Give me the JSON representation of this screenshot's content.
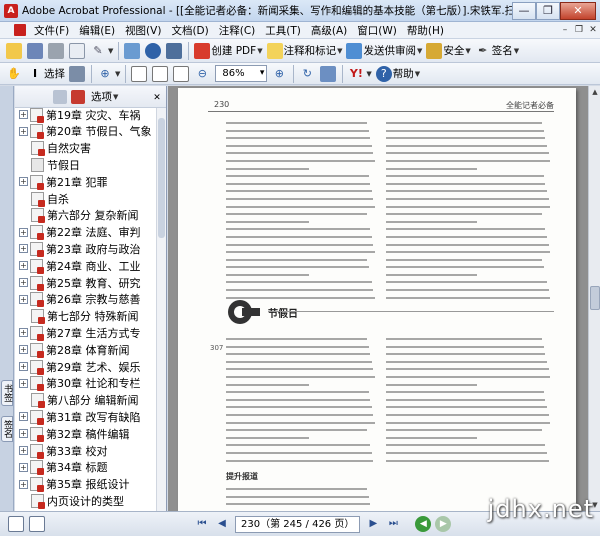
{
  "window": {
    "title": "Adobe Acrobat Professional - [[全能记者必备：新闻采集、写作和编辑的基本技能（第七版）].宋铁军.扫描版.pdf]",
    "minimize": "—",
    "restore": "❐",
    "close": "✕"
  },
  "menu": [
    "文件(F)",
    "编辑(E)",
    "视图(V)",
    "文档(D)",
    "注释(C)",
    "工具(T)",
    "高级(A)",
    "窗口(W)",
    "帮助(H)"
  ],
  "toolbar1": {
    "create_pdf": "创建 PDF",
    "comment_markup": "注释和标记",
    "send_review": "发送供审阅",
    "security": "安全",
    "sign": "签名"
  },
  "toolbar2": {
    "select": "选择",
    "zoom": "86%",
    "help": "帮助"
  },
  "left_tabs": {
    "bookmarks": "书签",
    "signatures": "签名"
  },
  "bookmarks_panel": {
    "options": "选项"
  },
  "bookmarks": [
    {
      "label": "第19章 灾灾、车祸",
      "level": 0,
      "expanded": true,
      "icon": "red"
    },
    {
      "label": "第20章 节假日、气象",
      "level": 0,
      "expanded": true,
      "icon": "red"
    },
    {
      "label": "自然灾害",
      "level": 1,
      "icon": "red"
    },
    {
      "label": "节假日",
      "level": 1,
      "icon": "gray"
    },
    {
      "label": "第21章 犯罪",
      "level": 0,
      "expanded": true,
      "icon": "red"
    },
    {
      "label": "自杀",
      "level": 1,
      "icon": "red"
    },
    {
      "label": "第六部分 复杂新闻",
      "level": 1,
      "icon": "red"
    },
    {
      "label": "第22章 法庭、审判",
      "level": 0,
      "expanded": true,
      "icon": "red"
    },
    {
      "label": "第23章 政府与政治",
      "level": 0,
      "expanded": true,
      "icon": "red"
    },
    {
      "label": "第24章 商业、工业",
      "level": 0,
      "expanded": true,
      "icon": "red"
    },
    {
      "label": "第25章 教育、研究",
      "level": 0,
      "expanded": true,
      "icon": "red"
    },
    {
      "label": "第26章 宗教与慈善",
      "level": 0,
      "expanded": true,
      "icon": "red"
    },
    {
      "label": "第七部分 特殊新闻",
      "level": 1,
      "icon": "red"
    },
    {
      "label": "第27章 生活方式专",
      "level": 0,
      "expanded": true,
      "icon": "red"
    },
    {
      "label": "第28章 体育新闻",
      "level": 0,
      "expanded": true,
      "icon": "red"
    },
    {
      "label": "第29章 艺术、娱乐",
      "level": 0,
      "expanded": true,
      "icon": "red"
    },
    {
      "label": "第30章 社论和专栏",
      "level": 0,
      "expanded": true,
      "icon": "red"
    },
    {
      "label": "第八部分 编辑新闻",
      "level": 1,
      "icon": "red"
    },
    {
      "label": "第31章 改写有缺陷",
      "level": 0,
      "expanded": true,
      "icon": "red"
    },
    {
      "label": "第32章 稿件编辑",
      "level": 0,
      "expanded": true,
      "icon": "red"
    },
    {
      "label": "第33章 校对",
      "level": 0,
      "expanded": true,
      "icon": "red"
    },
    {
      "label": "第34章 标题",
      "level": 0,
      "expanded": true,
      "icon": "red"
    },
    {
      "label": "第35章 报纸设计",
      "level": 0,
      "expanded": true,
      "icon": "red"
    },
    {
      "label": "内页设计的类型",
      "level": 1,
      "icon": "red"
    }
  ],
  "page": {
    "page_number": "230",
    "running_head": "全能记者必备",
    "section_title": "节假日",
    "margin_note": "307",
    "subhead": "提升报道"
  },
  "status": {
    "page_indicator": "230（第 245 / 426 页）"
  },
  "watermark": "jdhx.net"
}
